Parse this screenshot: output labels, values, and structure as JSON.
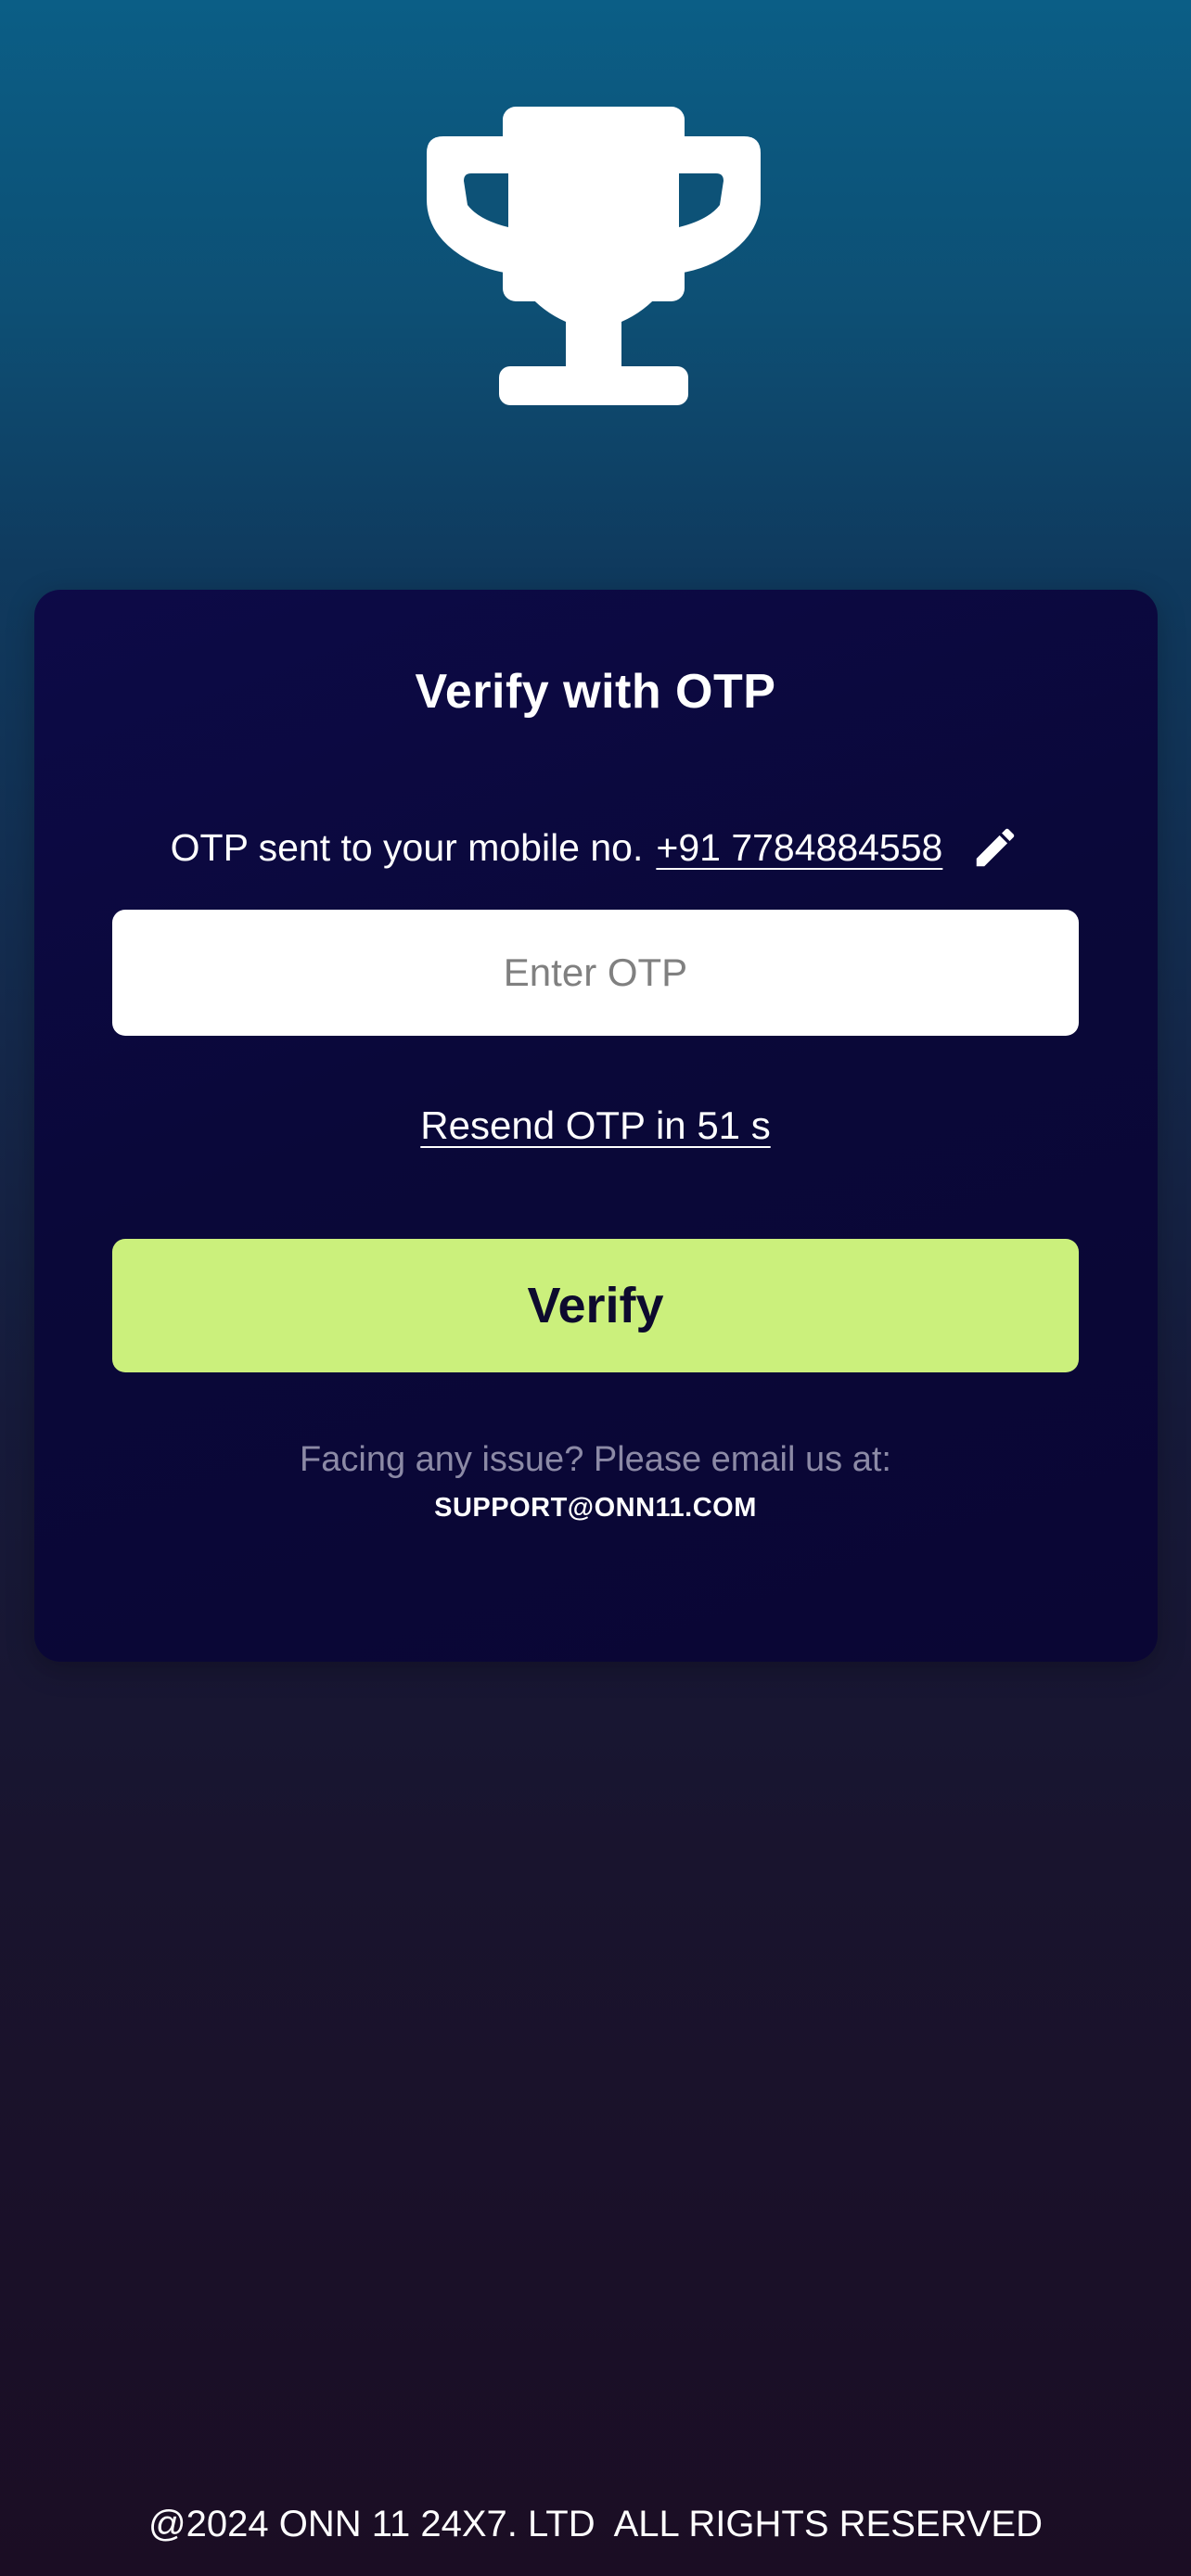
{
  "logo": {
    "icon": "trophy-icon",
    "color": "#ffffff"
  },
  "card": {
    "title": "Verify with OTP",
    "otp_info": {
      "text": "OTP sent to your mobile no.",
      "phone": "+91 7784884558",
      "edit_icon": "pencil-icon"
    },
    "otp_input": {
      "placeholder": "Enter OTP",
      "value": ""
    },
    "resend_label": "Resend OTP in 51 s",
    "verify_label": "Verify",
    "issue_text": "Facing any issue? Please email us at:",
    "support_email": "SUPPORT@ONN11.COM"
  },
  "footer": {
    "text": "@2024 ONN 11 24X7. LTD  ALL RIGHTS RESERVED"
  },
  "colors": {
    "accent_button": "#cbf07c",
    "card_background": "#0a0839",
    "muted_text": "#8c8aa6"
  }
}
